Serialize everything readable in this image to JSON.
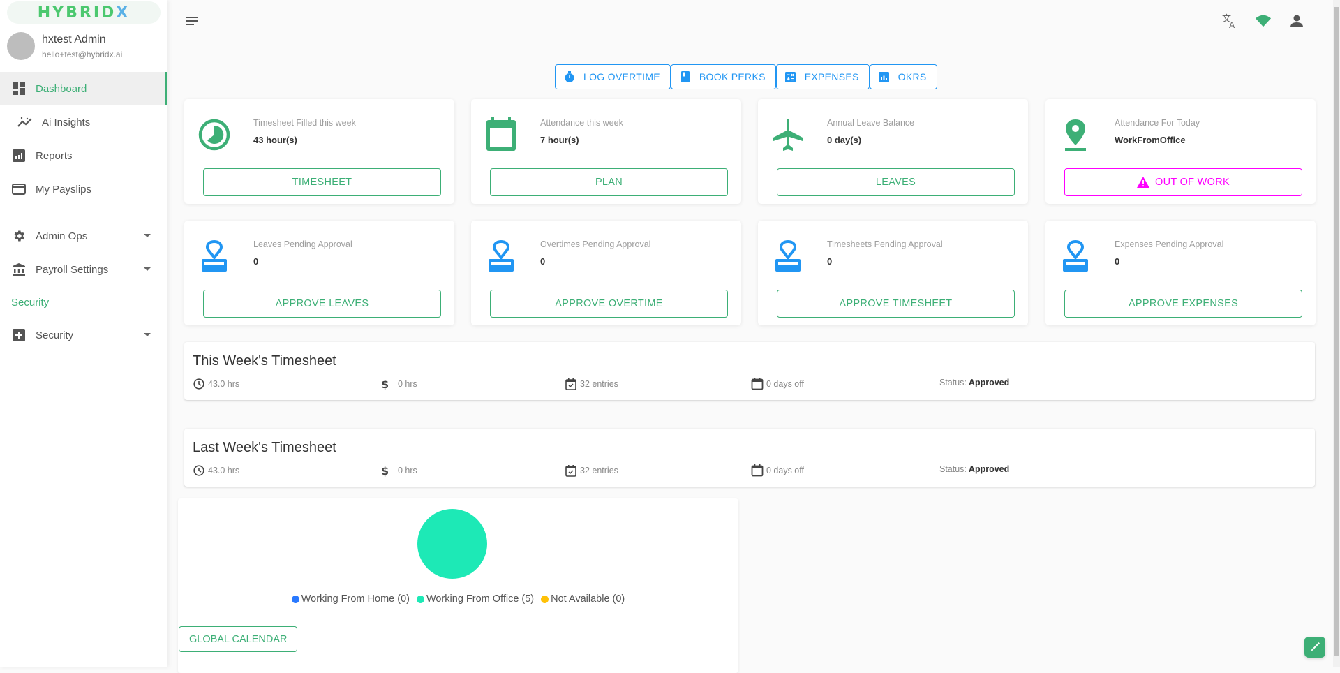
{
  "brand": {
    "logo_text_main": "HYBRID",
    "logo_text_x": "X",
    "accent": "#3daf76",
    "secondary": "#2196f3",
    "warning": "#ff00ff"
  },
  "user": {
    "name": "hxtest Admin",
    "email": "hello+test@hybridx.ai"
  },
  "sidebar": {
    "items": [
      {
        "label": "Dashboard",
        "icon": "dashboard-icon",
        "active": true
      },
      {
        "label": "Ai Insights",
        "icon": "insights-icon"
      },
      {
        "label": "Reports",
        "icon": "reports-icon"
      },
      {
        "label": "My Payslips",
        "icon": "payslip-card-icon"
      },
      {
        "label": "Admin Ops",
        "icon": "gear-icon",
        "expandable": true
      },
      {
        "label": "Payroll Settings",
        "icon": "bank-icon",
        "expandable": true
      }
    ],
    "section_label": "Security",
    "security_item": {
      "label": "Security",
      "icon": "plus-box-icon",
      "expandable": true
    }
  },
  "header": {
    "icons": [
      "translate-icon",
      "wifi-icon",
      "account-icon"
    ]
  },
  "quick_actions": [
    {
      "label": "LOG OVERTIME",
      "icon": "stopwatch-icon"
    },
    {
      "label": "BOOK PERKS",
      "icon": "book-icon"
    },
    {
      "label": "EXPENSES",
      "icon": "calculator-icon"
    },
    {
      "label": "OKRS",
      "icon": "chart-box-icon"
    }
  ],
  "cards": [
    {
      "label": "Timesheet Filled this week",
      "value": "43 hour(s)",
      "button": "TIMESHEET",
      "icon": "clock-pie-icon"
    },
    {
      "label": "Attendance this week",
      "value": "7 hour(s)",
      "button": "PLAN",
      "icon": "calendar-icon"
    },
    {
      "label": "Annual Leave Balance",
      "value": "0 day(s)",
      "button": "LEAVES",
      "icon": "airplane-icon"
    },
    {
      "label": "Attendance For Today",
      "value": "WorkFromOffice",
      "button": "OUT OF WORK",
      "icon": "map-marker-icon"
    },
    {
      "label": "Leaves Pending Approval",
      "value": "0",
      "button": "APPROVE LEAVES",
      "icon": "stamp-icon"
    },
    {
      "label": "Overtimes Pending Approval",
      "value": "0",
      "button": "APPROVE OVERTIME",
      "icon": "stamp-icon"
    },
    {
      "label": "Timesheets Pending Approval",
      "value": "0",
      "button": "APPROVE TIMESHEET",
      "icon": "stamp-icon"
    },
    {
      "label": "Expenses Pending Approval",
      "value": "0",
      "button": "APPROVE EXPENSES",
      "icon": "stamp-icon"
    }
  ],
  "timesheets": [
    {
      "title": "This Week's Timesheet",
      "hours": "43.0 hrs",
      "billable": "0 hrs",
      "entries": "32 entries",
      "days_off": "0 days off",
      "status_label": "Status:",
      "status": "Approved"
    },
    {
      "title": "Last Week's Timesheet",
      "hours": "43.0 hrs",
      "billable": "0 hrs",
      "entries": "32 entries",
      "days_off": "0 days off",
      "status_label": "Status:",
      "status": "Approved"
    }
  ],
  "attendance_chart": {
    "legend": [
      {
        "label": "Working From Home (0)",
        "color": "#2979ff"
      },
      {
        "label": "Working From Office (5)",
        "color": "#1de9b6"
      },
      {
        "label": "Not Available (0)",
        "color": "#ffc107"
      }
    ],
    "global_calendar_label": "GLOBAL CALENDAR"
  },
  "chart_data": {
    "type": "pie",
    "title": "",
    "categories": [
      "Working From Home",
      "Working From Office",
      "Not Available"
    ],
    "values": [
      0,
      5,
      0
    ],
    "colors": [
      "#2979ff",
      "#1de9b6",
      "#ffc107"
    ],
    "legend": "bottom"
  }
}
